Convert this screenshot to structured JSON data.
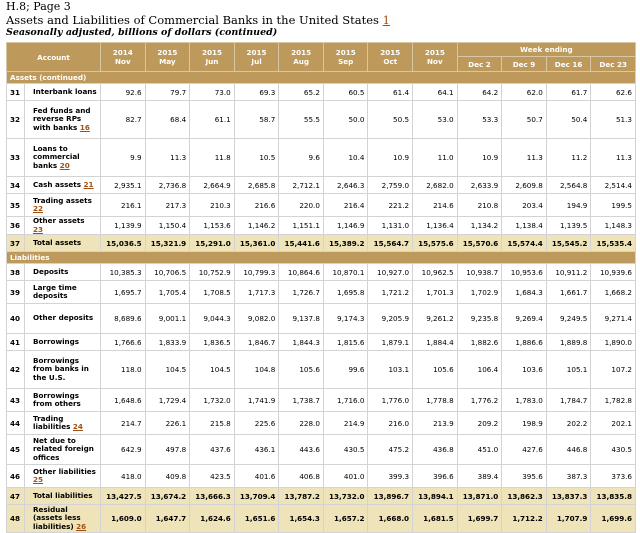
{
  "page_ref": "H.8; Page 3",
  "title": "Assets and Liabilities of Commercial Banks in the United States",
  "title_footnote": "1",
  "subtitle": "Seasonally adjusted, billions of dollars (continued)",
  "table": {
    "account_header": "Account",
    "week_ending_header": "Week ending",
    "monthly_columns": [
      {
        "year": "2014",
        "month": "Nov"
      },
      {
        "year": "2015",
        "month": "May"
      },
      {
        "year": "2015",
        "month": "Jun"
      },
      {
        "year": "2015",
        "month": "Jul"
      },
      {
        "year": "2015",
        "month": "Aug"
      },
      {
        "year": "2015",
        "month": "Sep"
      },
      {
        "year": "2015",
        "month": "Oct"
      },
      {
        "year": "2015",
        "month": "Nov"
      }
    ],
    "weekly_columns": [
      "Dec 2",
      "Dec 9",
      "Dec 16",
      "Dec 23"
    ],
    "sections": [
      {
        "title": "Assets (continued)",
        "rows": [
          {
            "line": "31",
            "label": "Interbank loans",
            "fn": "",
            "values": [
              "92.6",
              "79.7",
              "73.0",
              "69.3",
              "65.2",
              "60.5",
              "61.4",
              "64.1",
              "64.2",
              "62.0",
              "61.7",
              "62.6"
            ]
          },
          {
            "line": "32",
            "label": "Fed funds and reverse RPs with banks",
            "fn": "16",
            "values": [
              "82.7",
              "68.4",
              "61.1",
              "58.7",
              "55.5",
              "50.0",
              "50.5",
              "53.0",
              "53.3",
              "50.7",
              "50.4",
              "51.3"
            ]
          },
          {
            "line": "33",
            "label": "Loans to commercial banks",
            "fn": "20",
            "values": [
              "9.9",
              "11.3",
              "11.8",
              "10.5",
              "9.6",
              "10.4",
              "10.9",
              "11.0",
              "10.9",
              "11.3",
              "11.2",
              "11.3"
            ]
          },
          {
            "line": "34",
            "label": "Cash assets",
            "fn": "21",
            "values": [
              "2,935.1",
              "2,736.8",
              "2,664.9",
              "2,685.8",
              "2,712.1",
              "2,646.3",
              "2,759.0",
              "2,682.0",
              "2,633.9",
              "2,609.8",
              "2,564.8",
              "2,514.4"
            ]
          },
          {
            "line": "35",
            "label": "Trading assets",
            "fn": "22",
            "values": [
              "216.1",
              "217.3",
              "210.3",
              "216.6",
              "220.0",
              "216.4",
              "221.2",
              "214.6",
              "210.8",
              "203.4",
              "194.9",
              "199.5"
            ]
          },
          {
            "line": "36",
            "label": "Other assets",
            "fn": "23",
            "values": [
              "1,139.9",
              "1,150.4",
              "1,153.6",
              "1,146.2",
              "1,151.1",
              "1,146.9",
              "1,131.0",
              "1,136.4",
              "1,134.2",
              "1,138.4",
              "1,139.5",
              "1,148.3"
            ]
          },
          {
            "line": "37",
            "label": "Total assets",
            "fn": "",
            "total": true,
            "values": [
              "15,036.5",
              "15,321.9",
              "15,291.0",
              "15,361.0",
              "15,441.6",
              "15,389.2",
              "15,564.7",
              "15,575.6",
              "15,570.6",
              "15,574.4",
              "15,545.2",
              "15,535.4"
            ]
          }
        ]
      },
      {
        "title": "Liabilities",
        "rows": [
          {
            "line": "38",
            "label": "Deposits",
            "fn": "",
            "values": [
              "10,385.3",
              "10,706.5",
              "10,752.9",
              "10,799.3",
              "10,864.6",
              "10,870.1",
              "10,927.0",
              "10,962.5",
              "10,938.7",
              "10,953.6",
              "10,911.2",
              "10,939.6"
            ]
          },
          {
            "line": "39",
            "label": "Large time deposits",
            "fn": "",
            "values": [
              "1,695.7",
              "1,705.4",
              "1,708.5",
              "1,717.3",
              "1,726.7",
              "1,695.8",
              "1,721.2",
              "1,701.3",
              "1,702.9",
              "1,684.3",
              "1,661.7",
              "1,668.2"
            ]
          },
          {
            "line": "40",
            "label": "Other deposits",
            "fn": "",
            "values": [
              "8,689.6",
              "9,001.1",
              "9,044.3",
              "9,082.0",
              "9,137.8",
              "9,174.3",
              "9,205.9",
              "9,261.2",
              "9,235.8",
              "9,269.4",
              "9,249.5",
              "9,271.4"
            ]
          },
          {
            "line": "41",
            "label": "Borrowings",
            "fn": "",
            "values": [
              "1,766.6",
              "1,833.9",
              "1,836.5",
              "1,846.7",
              "1,844.3",
              "1,815.6",
              "1,879.1",
              "1,884.4",
              "1,882.6",
              "1,886.6",
              "1,889.8",
              "1,890.0"
            ]
          },
          {
            "line": "42",
            "label": "Borrowings from banks in the U.S.",
            "fn": "",
            "values": [
              "118.0",
              "104.5",
              "104.5",
              "104.8",
              "105.6",
              "99.6",
              "103.1",
              "105.6",
              "106.4",
              "103.6",
              "105.1",
              "107.2"
            ]
          },
          {
            "line": "43",
            "label": "Borrowings from others",
            "fn": "",
            "values": [
              "1,648.6",
              "1,729.4",
              "1,732.0",
              "1,741.9",
              "1,738.7",
              "1,716.0",
              "1,776.0",
              "1,778.8",
              "1,776.2",
              "1,783.0",
              "1,784.7",
              "1,782.8"
            ]
          },
          {
            "line": "44",
            "label": "Trading liabilities",
            "fn": "24",
            "values": [
              "214.7",
              "226.1",
              "215.8",
              "225.6",
              "228.0",
              "214.9",
              "216.0",
              "213.9",
              "209.2",
              "198.9",
              "202.2",
              "202.1"
            ]
          },
          {
            "line": "45",
            "label": "Net due to related foreign offices",
            "fn": "",
            "values": [
              "642.9",
              "497.8",
              "437.6",
              "436.1",
              "443.6",
              "430.5",
              "475.2",
              "436.8",
              "451.0",
              "427.6",
              "446.8",
              "430.5"
            ]
          },
          {
            "line": "46",
            "label": "Other liabilities",
            "fn": "25",
            "values": [
              "418.0",
              "409.8",
              "423.5",
              "401.6",
              "406.8",
              "401.0",
              "399.3",
              "396.6",
              "389.4",
              "395.6",
              "387.3",
              "373.6"
            ]
          },
          {
            "line": "47",
            "label": "Total liabilities",
            "fn": "",
            "total": true,
            "values": [
              "13,427.5",
              "13,674.2",
              "13,666.3",
              "13,709.4",
              "13,787.2",
              "13,732.0",
              "13,896.7",
              "13,894.1",
              "13,871.0",
              "13,862.3",
              "13,837.3",
              "13,835.8"
            ]
          },
          {
            "line": "48",
            "label": "Residual (assets less liabilities)",
            "fn": "26",
            "total": true,
            "values": [
              "1,609.0",
              "1,647.7",
              "1,624.6",
              "1,651.6",
              "1,654.3",
              "1,657.2",
              "1,668.0",
              "1,681.5",
              "1,699.7",
              "1,712.2",
              "1,707.9",
              "1,699.6"
            ]
          }
        ]
      }
    ]
  }
}
